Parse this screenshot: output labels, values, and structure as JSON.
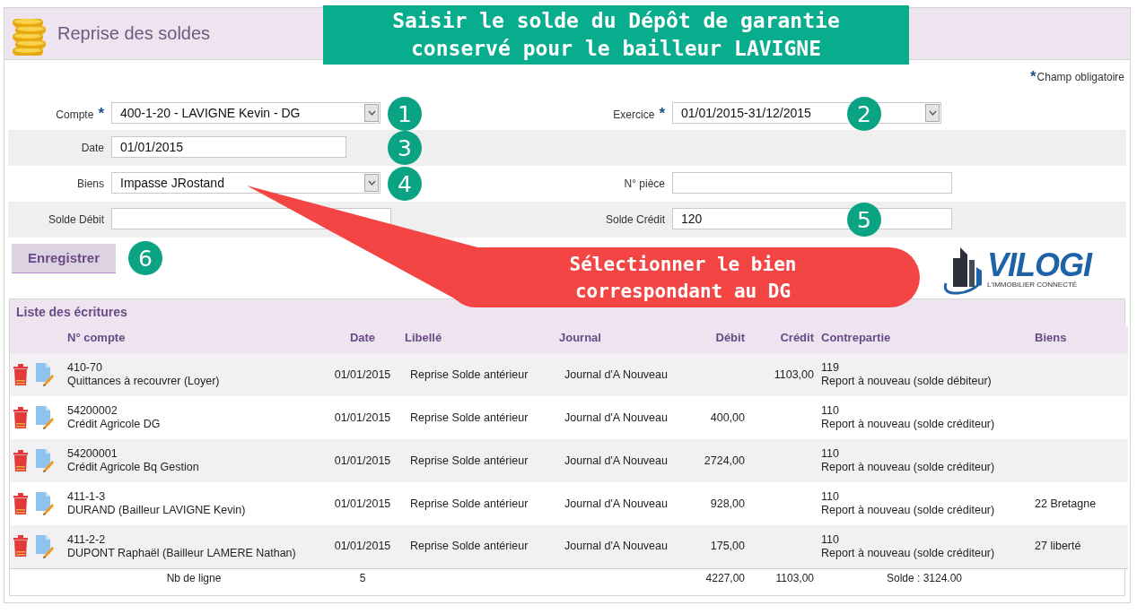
{
  "page": {
    "title": "Reprise des soldes"
  },
  "banner": {
    "lines": [
      "Saisir le solde du Dépôt de garantie",
      "conservé pour le bailleur LAVIGNE"
    ]
  },
  "callout": {
    "lines": [
      "Sélectionner le bien",
      "correspondant au DG"
    ]
  },
  "logo": {
    "name": "VILOGI",
    "tagline": "L'IMMOBILIER CONNECTÉ"
  },
  "required_note": {
    "mark": "*",
    "text": "Champ obligatoire"
  },
  "form": {
    "rows": [
      {
        "left": {
          "label": "Compte",
          "mark": "*",
          "kind": "select",
          "value": "400-1-20 - LAVIGNE Kevin - DG",
          "step": "1"
        },
        "right": {
          "label": "Exercice",
          "mark": "*",
          "kind": "select",
          "value": "01/01/2015-31/12/2015",
          "step": "2"
        }
      },
      {
        "left": {
          "label": "Date",
          "kind": "input",
          "value": "01/01/2015",
          "step": "3"
        }
      },
      {
        "left": {
          "label": "Biens",
          "kind": "select",
          "value": "Impasse JRostand",
          "step": "4"
        },
        "right": {
          "label": "N° pièce",
          "kind": "input"
        }
      },
      {
        "left": {
          "label": "Solde Débit",
          "kind": "input"
        },
        "right": {
          "label": "Solde Crédit",
          "kind": "input",
          "value": "120",
          "step": "5"
        }
      }
    ],
    "save": {
      "label": "Enregistrer",
      "step": "6"
    }
  },
  "table": {
    "title": "Liste des écritures",
    "columns": [
      "N° compte",
      "Date",
      "Libellé",
      "Journal",
      "Débit",
      "Crédit",
      "Contrepartie",
      "Biens"
    ],
    "rows": [
      {
        "account": [
          "410-70",
          "Quittances à recouvrer (Loyer)"
        ],
        "date": "01/01/2015",
        "label": "Reprise Solde antérieur",
        "journal": "Journal d'A Nouveau",
        "debit": "",
        "credit": "1103,00",
        "counterpart": [
          "119",
          "Report à nouveau (solde débiteur)"
        ],
        "property": ""
      },
      {
        "account": [
          "54200002",
          "Crédit Agricole DG"
        ],
        "date": "01/01/2015",
        "label": "Reprise Solde antérieur",
        "journal": "Journal d'A Nouveau",
        "debit": "400,00",
        "credit": "",
        "counterpart": [
          "110",
          "Report à nouveau (solde créditeur)"
        ],
        "property": ""
      },
      {
        "account": [
          "54200001",
          "Crédit Agricole Bq Gestion"
        ],
        "date": "01/01/2015",
        "label": "Reprise Solde antérieur",
        "journal": "Journal d'A Nouveau",
        "debit": "2724,00",
        "credit": "",
        "counterpart": [
          "110",
          "Report à nouveau (solde créditeur)"
        ],
        "property": ""
      },
      {
        "account": [
          "411-1-3",
          "DURAND (Bailleur LAVIGNE Kevin)"
        ],
        "date": "01/01/2015",
        "label": "Reprise Solde antérieur",
        "journal": "Journal d'A Nouveau",
        "debit": "928,00",
        "credit": "",
        "counterpart": [
          "110",
          "Report à nouveau (solde créditeur)"
        ],
        "property": "22 Bretagne"
      },
      {
        "account": [
          "411-2-2",
          "DUPONT Raphaël (Bailleur LAMERE Nathan)"
        ],
        "date": "01/01/2015",
        "label": "Reprise Solde antérieur",
        "journal": "Journal d'A Nouveau",
        "debit": "175,00",
        "credit": "",
        "counterpart": [
          "110",
          "Report à nouveau (solde créditeur)"
        ],
        "property": "27 liberté"
      }
    ],
    "footer": {
      "count_label": "Nb de ligne",
      "count": "5",
      "debit_total": "4227,00",
      "credit_total": "1103,00",
      "balance": "Solde : 3124.00"
    }
  }
}
